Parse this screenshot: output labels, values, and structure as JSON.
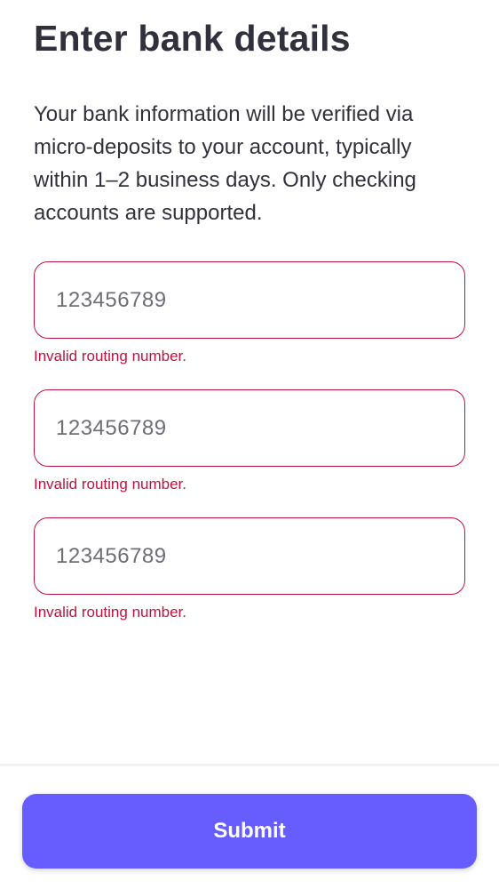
{
  "header": {
    "title": "Enter bank details"
  },
  "description": "Your bank information will be verified via micro-deposits to your account, typically within 1–2 business days. Only checking accounts are supported.",
  "fields": [
    {
      "placeholder": "123456789",
      "error": "Invalid routing number."
    },
    {
      "placeholder": "123456789",
      "error": "Invalid routing number."
    },
    {
      "placeholder": "123456789",
      "error": "Invalid routing number."
    }
  ],
  "footer": {
    "submit_label": "Submit"
  },
  "colors": {
    "text": "#30313d",
    "placeholder": "#6d6e78",
    "error": "#c0123c",
    "accent": "#675dff"
  }
}
